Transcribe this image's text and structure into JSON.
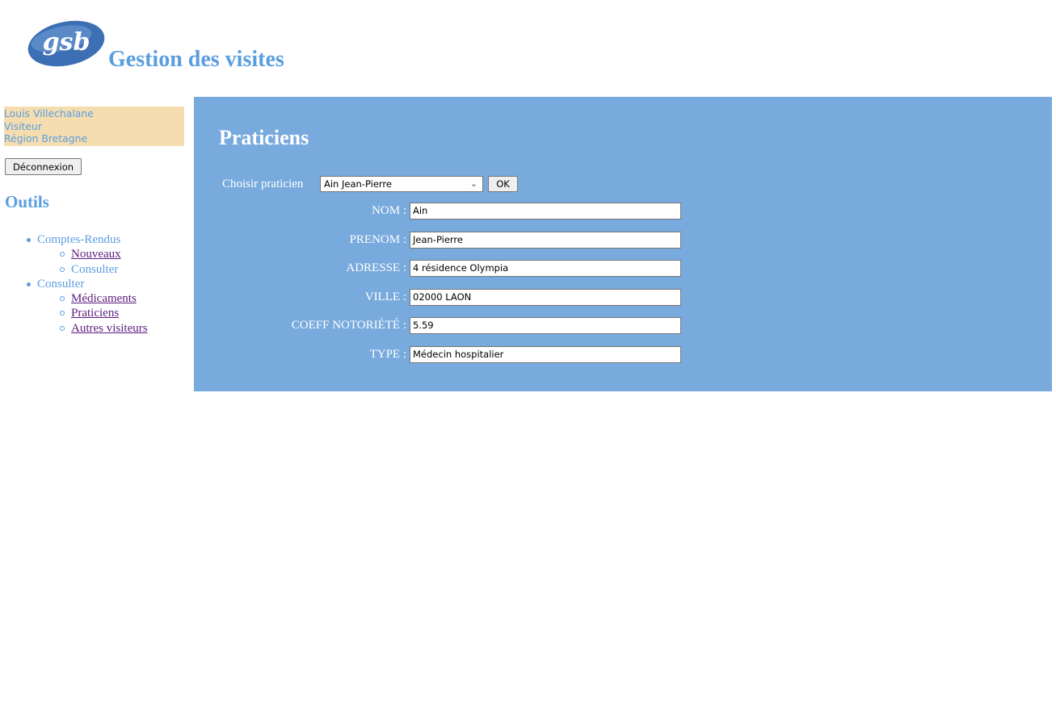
{
  "header": {
    "logo_text": "gsb",
    "title": "Gestion des visites"
  },
  "user": {
    "name": "Louis Villechalane",
    "role": "Visiteur",
    "region": "Région Bretagne"
  },
  "logout_label": "Déconnexion",
  "menu": {
    "title": "Outils",
    "groups": [
      {
        "label": "Comptes-Rendus",
        "items": [
          {
            "label": "Nouveaux",
            "link": true
          },
          {
            "label": "Consulter",
            "link": false
          }
        ]
      },
      {
        "label": "Consulter",
        "items": [
          {
            "label": "Médicaments",
            "link": true
          },
          {
            "label": "Praticiens",
            "link": true
          },
          {
            "label": "Autres visiteurs",
            "link": true
          }
        ]
      }
    ]
  },
  "content": {
    "title": "Praticiens",
    "choose_label": "Choisir praticien",
    "selected_praticien": "Ain Jean-Pierre",
    "ok_label": "OK",
    "fields": [
      {
        "label": "NOM :",
        "value": "Ain"
      },
      {
        "label": "PRENOM :",
        "value": "Jean-Pierre"
      },
      {
        "label": "ADRESSE :",
        "value": "4 résidence Olympia"
      },
      {
        "label": "VILLE :",
        "value": "02000 LAON"
      },
      {
        "label": "COEFF NOTORIÉTÉ :",
        "value": "5.59"
      },
      {
        "label": "TYPE :",
        "value": "Médecin hospitalier"
      }
    ]
  },
  "colors": {
    "accent": "#5b9ee0",
    "content_bg": "#78aadd",
    "user_box_bg": "#f5ddb0",
    "visited_link": "#5c1d7f"
  }
}
